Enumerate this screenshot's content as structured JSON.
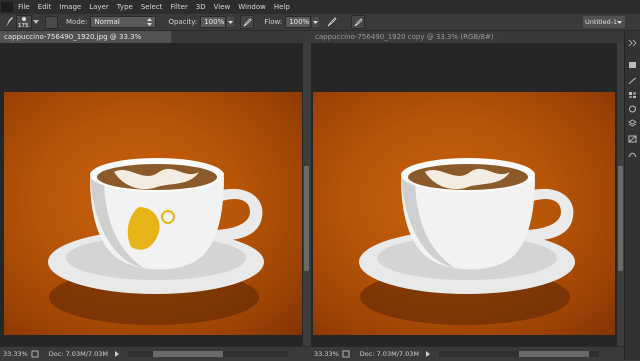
{
  "menu": [
    "File",
    "Edit",
    "Image",
    "Layer",
    "Type",
    "Select",
    "Filter",
    "3D",
    "View",
    "Window",
    "Help"
  ],
  "options": {
    "brush_size": "175",
    "mode_label": "Mode:",
    "mode_value": "Normal",
    "opacity_label": "Opacity:",
    "opacity_value": "100%",
    "flow_label": "Flow:",
    "flow_value": "100%",
    "workspace": "Untitled-1"
  },
  "docs": [
    {
      "tab": "cappuccino-756490_1920.jpg @ 33.3% (RGB/8#)",
      "close": "×",
      "zoom": "33.33%",
      "doc": "Doc: 7.03M/7.03M"
    },
    {
      "tab": "cappuccino-756490_1920 copy @ 33.3% (RGB/8#) *",
      "close": "×",
      "zoom": "33.33%",
      "doc": "Doc: 7.03M/7.03M"
    }
  ],
  "colors": {
    "accent": "#c3600a",
    "paint": "#e7b418"
  }
}
